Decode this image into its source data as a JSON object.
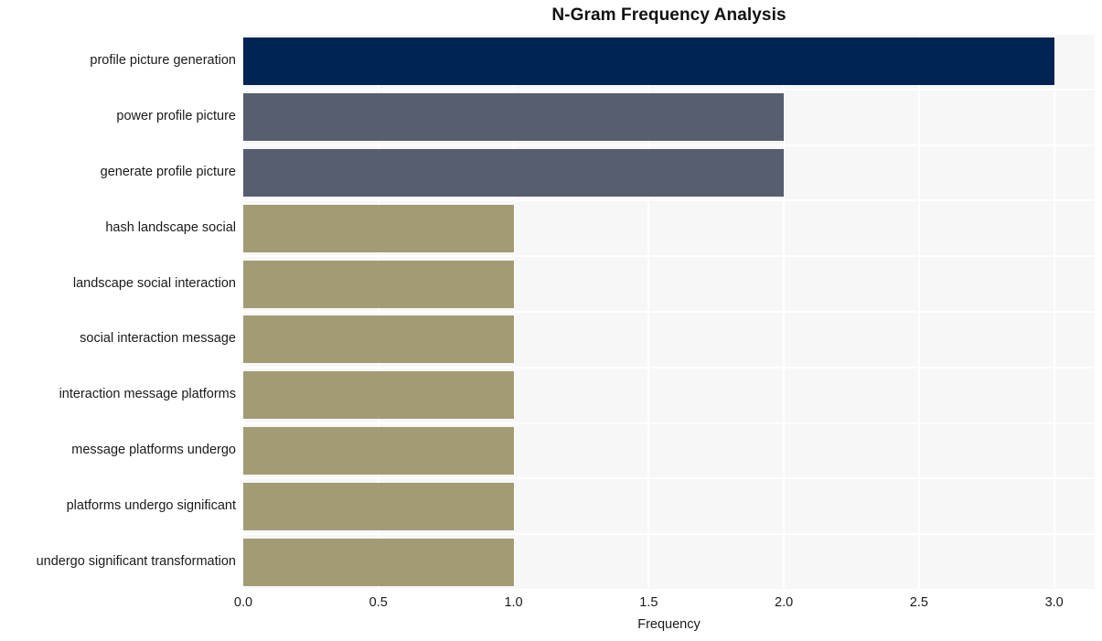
{
  "chart_data": {
    "type": "bar",
    "orientation": "horizontal",
    "title": "N-Gram Frequency Analysis",
    "xlabel": "Frequency",
    "ylabel": "",
    "xlim": [
      0.0,
      3.15
    ],
    "xticks": [
      "0.0",
      "0.5",
      "1.0",
      "1.5",
      "2.0",
      "2.5",
      "3.0"
    ],
    "xtick_values": [
      0.0,
      0.5,
      1.0,
      1.5,
      2.0,
      2.5,
      3.0
    ],
    "grid": true,
    "legend": "none",
    "categories": [
      "profile picture generation",
      "power profile picture",
      "generate profile picture",
      "hash landscape social",
      "landscape social interaction",
      "social interaction message",
      "interaction message platforms",
      "message platforms undergo",
      "platforms undergo significant",
      "undergo significant transformation"
    ],
    "values": [
      3,
      2,
      2,
      1,
      1,
      1,
      1,
      1,
      1,
      1
    ],
    "bar_colors": [
      "#002454",
      "#565e70",
      "#565e70",
      "#a39b74",
      "#a39b74",
      "#a39b74",
      "#a39b74",
      "#a39b74",
      "#a39b74",
      "#a39b74"
    ]
  },
  "style": {
    "plot_background": "#f7f7f7",
    "figure_background": "#ffffff",
    "gridline_color": "#ffffff",
    "text_color": "#1a1a1a",
    "title_color": "#111111"
  }
}
